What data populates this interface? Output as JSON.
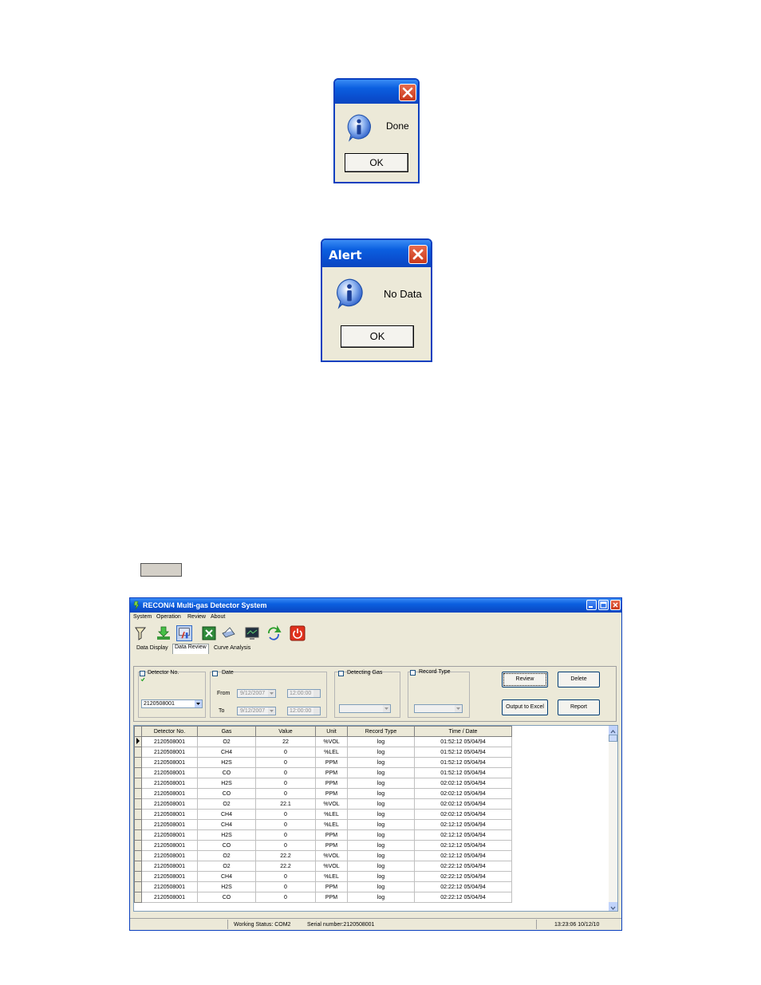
{
  "dialog_done": {
    "message": "Done",
    "ok_label": "OK"
  },
  "dialog_alert": {
    "title": "Alert",
    "message": "No Data",
    "ok_label": "OK"
  },
  "app": {
    "title": "RECON/4 Multi-gas Detector System",
    "menu": [
      "System",
      "Operation",
      "Review",
      "About"
    ],
    "toolbar_icons": [
      "detector-icon",
      "download-icon",
      "settings-tools-icon",
      "excel-icon",
      "print-icon",
      "monitor-icon",
      "refresh-icon",
      "power-icon"
    ],
    "tabs": [
      "Data Display",
      "Data Review",
      "Curve Analysis"
    ],
    "active_tab": "Data Review",
    "filters": {
      "detector_no_label": "Detector No.",
      "detector_no_value": "2120508001",
      "date_label": "Date",
      "from_label": "From",
      "to_label": "To",
      "from_date": "9/12/2007",
      "from_time": "12:00:00",
      "to_date": "9/12/2007",
      "to_time": "12:00:00",
      "detecting_gas_label": "Detecting Gas",
      "detecting_gas_value": "",
      "record_type_label": "Record Type",
      "record_type_value": ""
    },
    "buttons": {
      "review": "Review",
      "delete": "Delete",
      "output_excel": "Output to Excel",
      "report": "Report"
    },
    "table": {
      "columns": [
        "Detector No.",
        "Gas",
        "Value",
        "Unit",
        "Record Type",
        "Time / Date"
      ],
      "rows": [
        [
          "2120508001",
          "O2",
          "22",
          "%VOL",
          "log",
          "01:52:12 05/04/94"
        ],
        [
          "2120508001",
          "CH4",
          "0",
          "%LEL",
          "log",
          "01:52:12 05/04/94"
        ],
        [
          "2120508001",
          "H2S",
          "0",
          "PPM",
          "log",
          "01:52:12 05/04/94"
        ],
        [
          "2120508001",
          "CO",
          "0",
          "PPM",
          "log",
          "01:52:12 05/04/94"
        ],
        [
          "2120508001",
          "H2S",
          "0",
          "PPM",
          "log",
          "02:02:12 05/04/94"
        ],
        [
          "2120508001",
          "CO",
          "0",
          "PPM",
          "log",
          "02:02:12 05/04/94"
        ],
        [
          "2120508001",
          "O2",
          "22.1",
          "%VOL",
          "log",
          "02:02:12 05/04/94"
        ],
        [
          "2120508001",
          "CH4",
          "0",
          "%LEL",
          "log",
          "02:02:12 05/04/94"
        ],
        [
          "2120508001",
          "CH4",
          "0",
          "%LEL",
          "log",
          "02:12:12 05/04/94"
        ],
        [
          "2120508001",
          "H2S",
          "0",
          "PPM",
          "log",
          "02:12:12 05/04/94"
        ],
        [
          "2120508001",
          "CO",
          "0",
          "PPM",
          "log",
          "02:12:12 05/04/94"
        ],
        [
          "2120508001",
          "O2",
          "22.2",
          "%VOL",
          "log",
          "02:12:12 05/04/94"
        ],
        [
          "2120508001",
          "O2",
          "22.2",
          "%VOL",
          "log",
          "02:22:12 05/04/94"
        ],
        [
          "2120508001",
          "CH4",
          "0",
          "%LEL",
          "log",
          "02:22:12 05/04/94"
        ],
        [
          "2120508001",
          "H2S",
          "0",
          "PPM",
          "log",
          "02:22:12 05/04/94"
        ],
        [
          "2120508001",
          "CO",
          "0",
          "PPM",
          "log",
          "02:22:12 05/04/94"
        ]
      ]
    },
    "status": {
      "working_status": "Working Status:   COM2",
      "serial": "Serial number:2120508001",
      "clock": "13:23:06 10/12/10"
    }
  },
  "colors": {
    "xp_title_blue": "#0a5fe0",
    "close_red": "#d2462a",
    "face": "#ece9d8"
  }
}
